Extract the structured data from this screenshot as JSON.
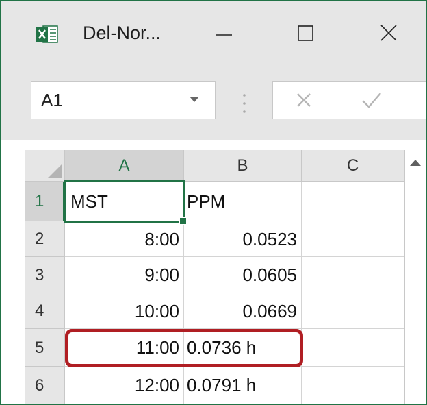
{
  "window": {
    "title": "Del-Nor...",
    "app_icon": "excel-icon",
    "buttons": [
      "minimize-icon",
      "maximize-icon",
      "close-icon"
    ]
  },
  "formula_bar": {
    "name_box_value": "A1",
    "cancel_icon": "cancel-x-icon",
    "enter_icon": "enter-check-icon"
  },
  "sheet": {
    "columns": [
      "A",
      "B",
      "C"
    ],
    "rows": [
      {
        "num": "1",
        "a": "MST",
        "b": "PPM",
        "c": ""
      },
      {
        "num": "2",
        "a": "8:00",
        "b": "0.0523",
        "c": ""
      },
      {
        "num": "3",
        "a": "9:00",
        "b": "0.0605",
        "c": ""
      },
      {
        "num": "4",
        "a": "10:00",
        "b": "0.0669",
        "c": ""
      },
      {
        "num": "5",
        "a": "11:00",
        "b": "0.0736 h",
        "c": ""
      },
      {
        "num": "6",
        "a": "12:00",
        "b": "0.0791 h",
        "c": ""
      }
    ],
    "active_cell": "A1",
    "highlighted_row": "5"
  },
  "colors": {
    "excel_green": "#217346",
    "highlight_red": "#b01e23",
    "chrome_gray": "#e6e6e6"
  }
}
